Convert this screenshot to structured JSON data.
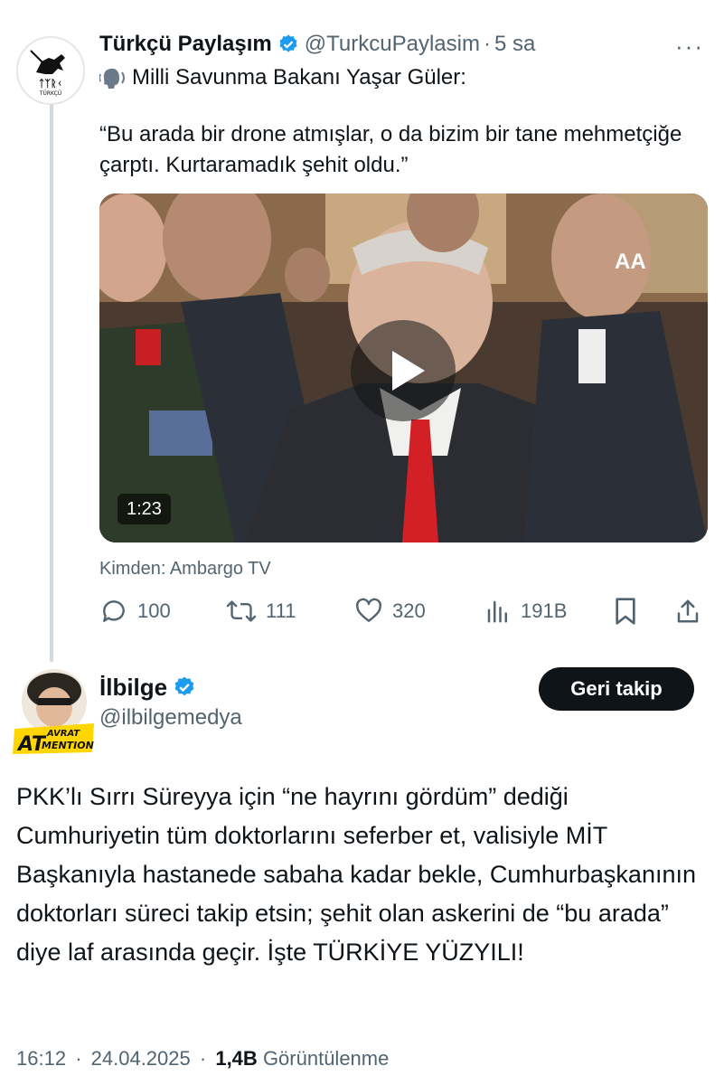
{
  "quoted_tweet": {
    "author_name": "Türkçü Paylaşım",
    "author_handle": "@TurkcuPaylasim",
    "separator": "·",
    "time": "5 sa",
    "more_label": "···",
    "avatar_text": "ᛏᛉᚱᚲ",
    "avatar_subtext": "TÜRKÇÜ",
    "line1": "Milli Savunma Bakanı Yaşar Güler:",
    "quote": "“Bu arada bir drone atmışlar, o da bizim bir tane mehmetçiğe çarptı. Kurtaramadık şehit oldu.”",
    "video": {
      "duration": "1:23",
      "watermark": "AA"
    },
    "source": "Kimden: Ambargo TV",
    "actions": {
      "replies": "100",
      "retweets": "111",
      "likes": "320",
      "views": "191B"
    }
  },
  "main_tweet": {
    "author_name": "İlbilge",
    "author_handle": "@ilbilgemedya",
    "follow_label": "Geri takip",
    "avatar_badge_line1": "AT",
    "avatar_badge_line2": "AVRAT",
    "avatar_badge_line3": "MENTION",
    "text": "PKK’lı Sırrı Süreyya için “ne hayrını gördüm” dediği Cumhuriyetin tüm doktorlarını seferber et, valisiyle MİT Başkanıyla hastanede sabaha kadar bekle, Cumhurbaşkanının doktorları süreci takip etsin; şehit olan askerini de “bu arada” diye laf arasında geçir. İşte TÜRKİYE YÜZYILI!",
    "time": "16:12",
    "date": "24.04.2025",
    "separator": "·",
    "views_count": "1,4B",
    "views_label": "Görüntülenme"
  },
  "colors": {
    "verified": "#1d9bf0",
    "muted": "#536471",
    "text": "#0f1419",
    "thread_line": "#cfd9de",
    "tie": "#d31f26"
  },
  "icons": [
    "verified-badge-icon",
    "speaking-head-icon",
    "more-icon",
    "play-icon",
    "reply-icon",
    "retweet-icon",
    "like-icon",
    "views-icon",
    "bookmark-icon",
    "share-icon"
  ]
}
